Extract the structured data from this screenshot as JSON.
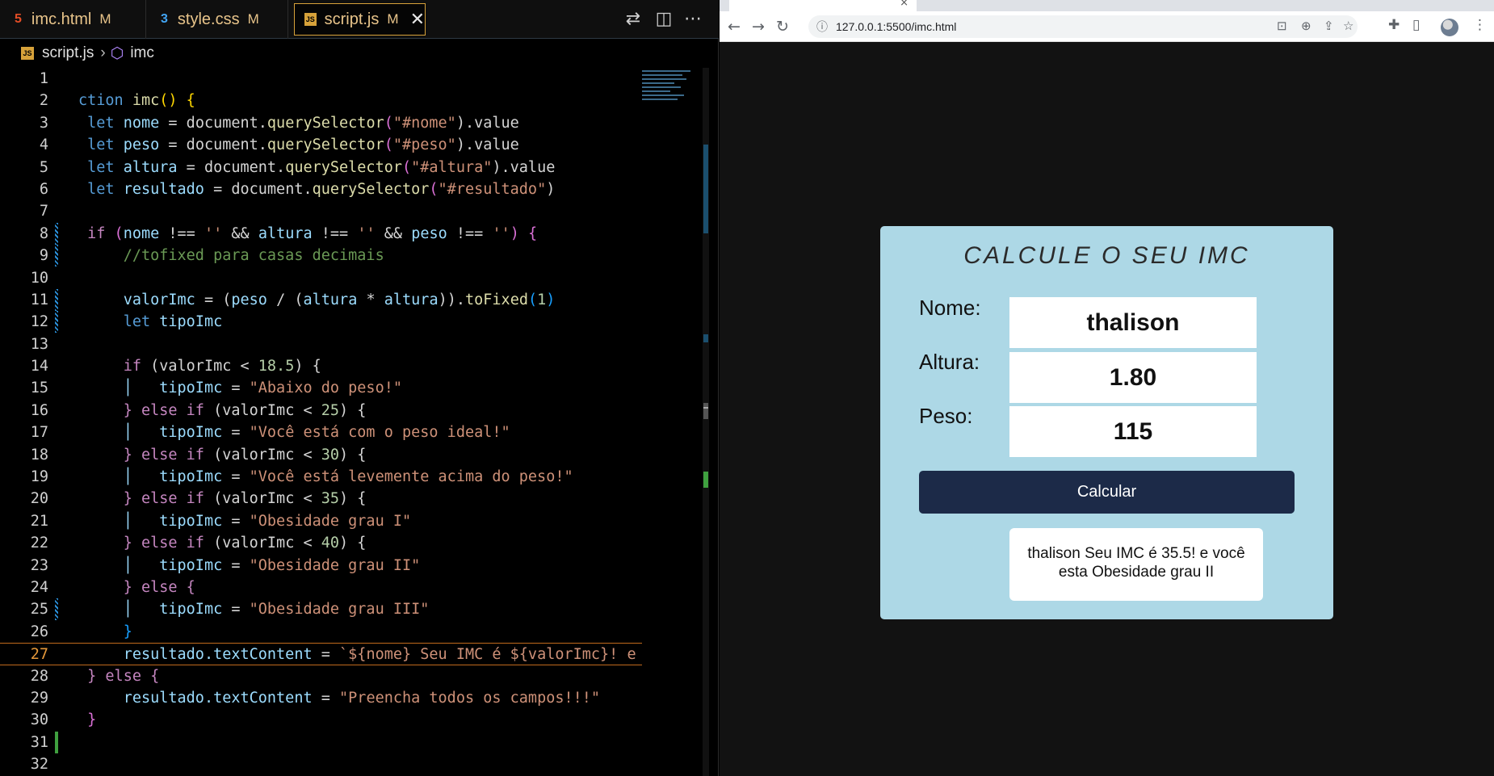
{
  "editor": {
    "tabs": [
      {
        "label": "imc.html",
        "icon": "html5-icon",
        "modified": "M"
      },
      {
        "label": "style.css",
        "icon": "css3-icon",
        "modified": "M"
      },
      {
        "label": "script.js",
        "icon": "js-icon",
        "modified": "M"
      }
    ],
    "close_glyph": "✕",
    "breadcrumb": {
      "file": "script.js",
      "symbol": "imc",
      "badge": "JS"
    },
    "code_lines": [
      {
        "n": "1"
      },
      {
        "n": "2"
      },
      {
        "n": "3"
      },
      {
        "n": "4"
      },
      {
        "n": "5"
      },
      {
        "n": "6"
      },
      {
        "n": "7"
      },
      {
        "n": "8"
      },
      {
        "n": "9"
      },
      {
        "n": "10"
      },
      {
        "n": "11"
      },
      {
        "n": "12"
      },
      {
        "n": "13"
      },
      {
        "n": "14"
      },
      {
        "n": "15"
      },
      {
        "n": "16"
      },
      {
        "n": "17"
      },
      {
        "n": "18"
      },
      {
        "n": "19"
      },
      {
        "n": "20"
      },
      {
        "n": "21"
      },
      {
        "n": "22"
      },
      {
        "n": "23"
      },
      {
        "n": "24"
      },
      {
        "n": "25"
      },
      {
        "n": "26"
      },
      {
        "n": "27"
      },
      {
        "n": "28"
      },
      {
        "n": "29"
      },
      {
        "n": "30"
      },
      {
        "n": "31"
      },
      {
        "n": "32"
      }
    ],
    "code": {
      "l2": {
        "a": "ction",
        "b": "imc",
        "c": "() {"
      },
      "l3": {
        "kw": "let",
        "v": "nome",
        "eq": " = document.",
        "fn": "querySelector",
        "s": "\"#nome\"",
        "t": ").value"
      },
      "l4": {
        "kw": "let",
        "v": "peso",
        "eq": " = document.",
        "fn": "querySelector",
        "s": "\"#peso\"",
        "t": ").value"
      },
      "l5": {
        "kw": "let",
        "v": "altura",
        "eq": " = document.",
        "fn": "querySelector",
        "s": "\"#altura\"",
        "t": ").value"
      },
      "l6": {
        "kw": "let",
        "v": "resultado",
        "eq": " = document.",
        "fn": "querySelector",
        "s": "\"#resultado\"",
        "t": ")"
      },
      "l8": {
        "kw": "if",
        "a": " (",
        "b": "nome",
        "c": " !== ",
        "s1": "''",
        "d": " && ",
        "e": "altura",
        "s2": "''",
        "f": "peso",
        "s3": "''",
        "g": ") {"
      },
      "l9": "//tofixed para casas decimais",
      "l11": {
        "a": "valorImc",
        "b": " = (",
        "c": "peso",
        "d": " / (",
        "e": "altura",
        "f": " * ",
        "g": "altura",
        "h": ")).",
        "fn": "toFixed",
        "i": "(",
        "num": "1",
        "j": ")"
      },
      "l12": {
        "kw": "let",
        "v": "tipoImc"
      },
      "l14": {
        "kw": "if",
        "a": " (valorImc < ",
        "num": "18.5",
        "b": ") {"
      },
      "l15": {
        "v": "tipoImc",
        "eq": " = ",
        "s": "\"Abaixo do peso!\""
      },
      "l16": {
        "kw": "} else if",
        "a": " (valorImc < ",
        "num": "25",
        "b": ") {"
      },
      "l17": {
        "v": "tipoImc",
        "eq": " = ",
        "s": "\"Você está com o peso ideal!\""
      },
      "l18": {
        "kw": "} else if",
        "a": " (valorImc < ",
        "num": "30",
        "b": ") {"
      },
      "l19": {
        "v": "tipoImc",
        "eq": " = ",
        "s": "\"Você está levemente acima do peso!\""
      },
      "l20": {
        "kw": "} else if",
        "a": " (valorImc < ",
        "num": "35",
        "b": ") {"
      },
      "l21": {
        "v": "tipoImc",
        "eq": " = ",
        "s": "\"Obesidade grau I\""
      },
      "l22": {
        "kw": "} else if",
        "a": " (valorImc < ",
        "num": "40",
        "b": ") {"
      },
      "l23": {
        "v": "tipoImc",
        "eq": " = ",
        "s": "\"Obesidade grau II\""
      },
      "l24": "} else {",
      "l25": {
        "v": "tipoImc",
        "eq": " = ",
        "s": "\"Obesidade grau III\""
      },
      "l26": "}",
      "l27": {
        "a": "resultado.textContent",
        "eq": " = ",
        "s": "`${nome} Seu IMC é ${valorImc}! e"
      },
      "l28": "} else {",
      "l29": {
        "a": "resultado.textContent",
        "eq": " = ",
        "s": "\"Preencha todos os campos!!!\""
      },
      "l30": "}"
    }
  },
  "browser": {
    "url": "127.0.0.1:5500/imc.html",
    "tab_close": "×",
    "nav": {
      "back": "←",
      "forward": "→",
      "reload": "↻",
      "info": "ⓘ"
    },
    "page": {
      "title": "CALCULE O SEU IMC",
      "fields": [
        {
          "label": "Nome:",
          "value": "thalison"
        },
        {
          "label": "Altura:",
          "value": "1.80"
        },
        {
          "label": "Peso:",
          "value": "115"
        }
      ],
      "button": "Calcular",
      "result": "thalison Seu IMC é 35.5! e você esta Obesidade grau II"
    }
  },
  "colors": {
    "tab_accent": "#d7a23a",
    "button": "#1c2a48",
    "card": "#add8e6",
    "current_line": "#c06a1c"
  }
}
